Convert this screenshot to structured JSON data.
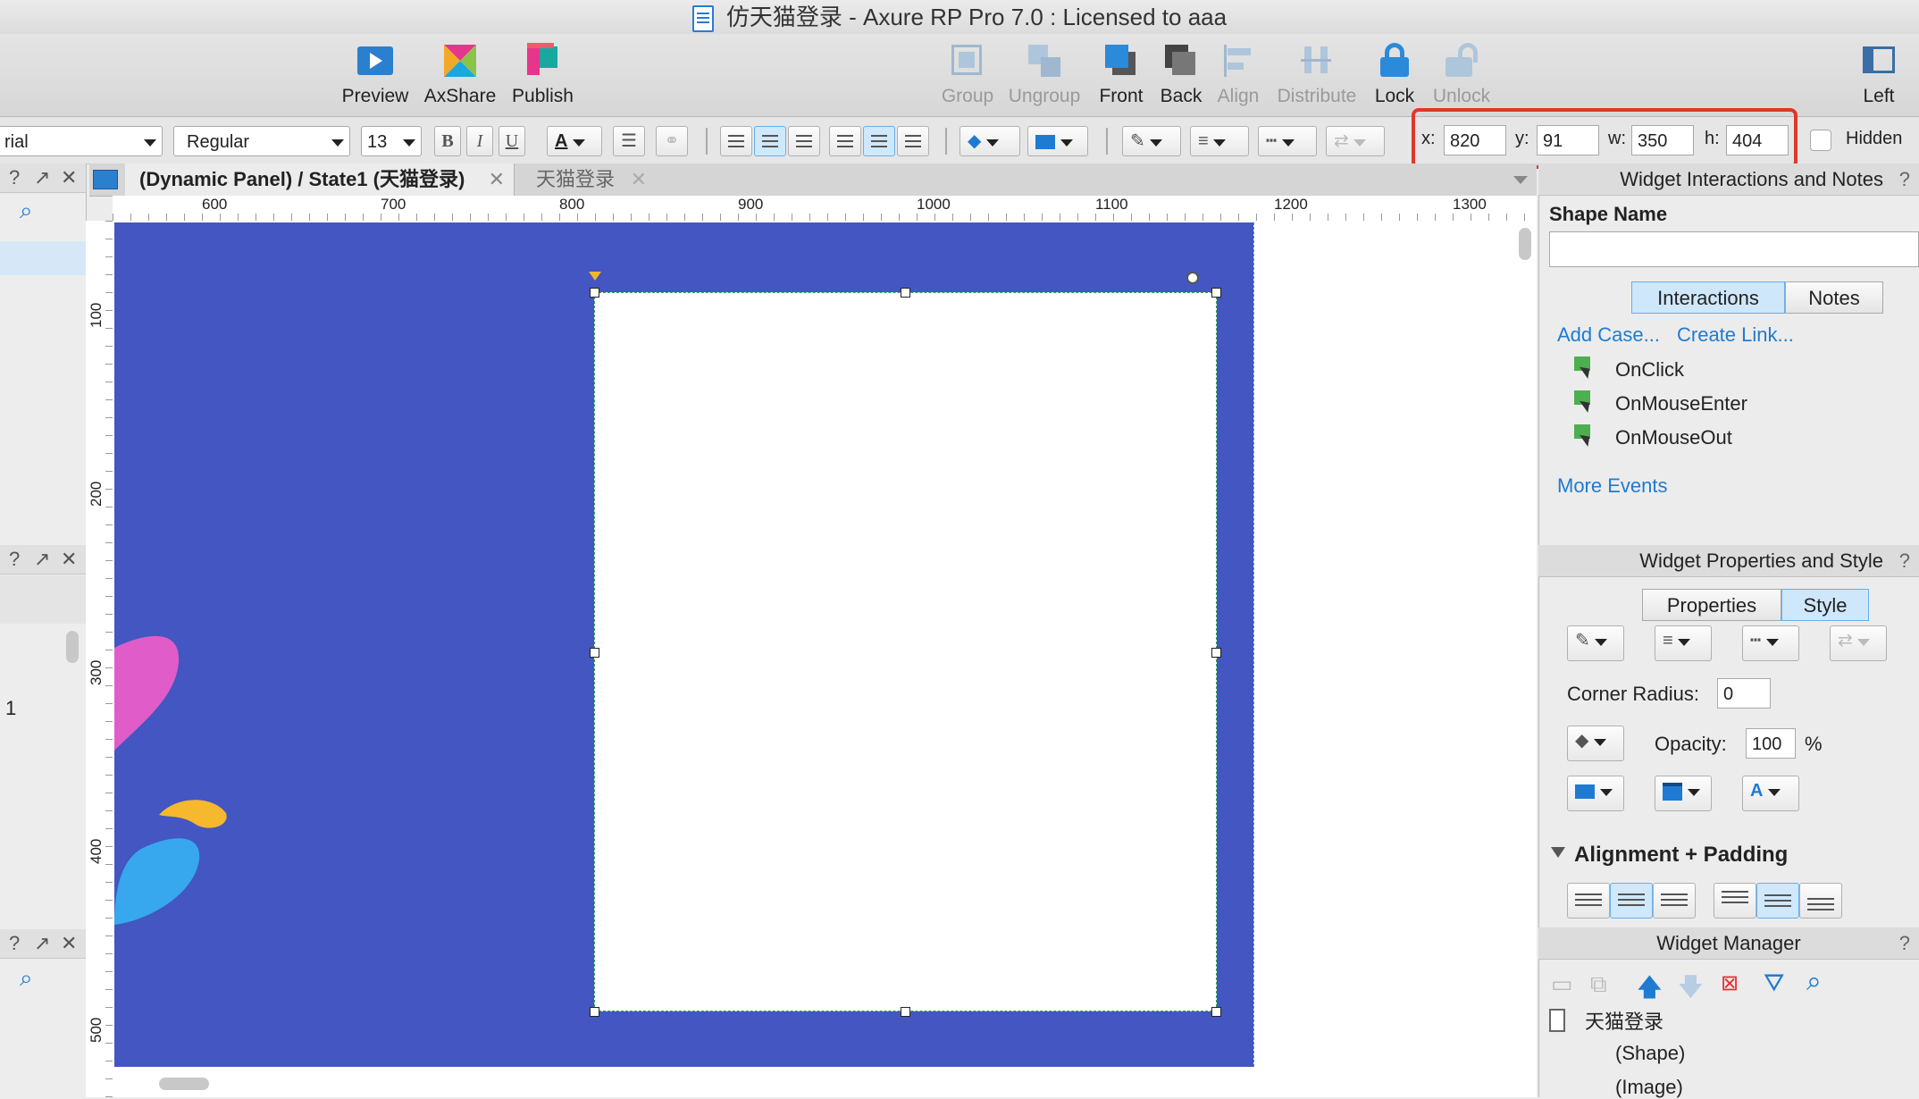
{
  "window": {
    "title": "仿天猫登录 - Axure RP Pro 7.0 : Licensed to aaa"
  },
  "toolbar": {
    "preview": "Preview",
    "axshare": "AxShare",
    "publish": "Publish",
    "group": "Group",
    "ungroup": "Ungroup",
    "front": "Front",
    "back": "Back",
    "align": "Align",
    "distribute": "Distribute",
    "lock": "Lock",
    "unlock": "Unlock",
    "left": "Left"
  },
  "format": {
    "font": "rial",
    "style": "Regular",
    "size": "13",
    "bold": "B",
    "italic": "I",
    "underline": "U"
  },
  "coords": {
    "x_label": "x:",
    "x": "820",
    "y_label": "y:",
    "y": "91",
    "w_label": "w:",
    "w": "350",
    "h_label": "h:",
    "h": "404",
    "hidden": "Hidden"
  },
  "tabs": [
    {
      "label": "(Dynamic Panel) / State1 (天猫登录)",
      "active": true
    },
    {
      "label": "天猫登录",
      "active": false
    }
  ],
  "ruler": {
    "h": [
      "600",
      "700",
      "800",
      "900",
      "1000",
      "1100",
      "1200",
      "1300"
    ],
    "v": [
      "100",
      "200",
      "300",
      "400",
      "500"
    ]
  },
  "left_panel": {
    "row_number": "1"
  },
  "inspector": {
    "interactions_header": "Widget Interactions and Notes",
    "shape_name_label": "Shape Name",
    "shape_name_value": "",
    "tab_interactions": "Interactions",
    "tab_notes": "Notes",
    "add_case": "Add Case...",
    "create_link": "Create Link...",
    "events": [
      "OnClick",
      "OnMouseEnter",
      "OnMouseOut"
    ],
    "more_events": "More Events",
    "properties_header": "Widget Properties and Style",
    "tab_properties": "Properties",
    "tab_style": "Style",
    "corner_radius_label": "Corner Radius:",
    "corner_radius": "0",
    "opacity_label": "Opacity:",
    "opacity": "100",
    "opacity_unit": "%",
    "alignment_label": "Alignment + Padding",
    "widget_manager_header": "Widget Manager",
    "tree": [
      "天猫登录",
      "(Shape)",
      "(Image)"
    ]
  },
  "colors": {
    "panel_blue": "#4356c1",
    "highlight_red": "#e0362a",
    "link_blue": "#1f7bd1",
    "selection_green": "#2fa34f"
  }
}
